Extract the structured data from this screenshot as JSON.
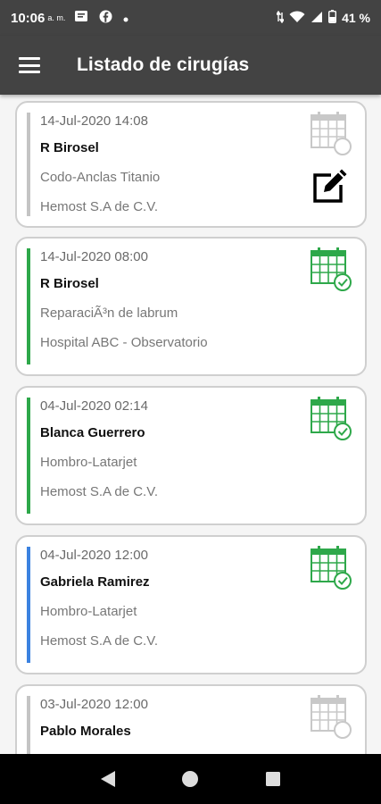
{
  "status_bar": {
    "time": "10:06",
    "ampm": "a. m.",
    "battery": "41 %",
    "icons": [
      "message-icon",
      "facebook-icon",
      "dot-icon",
      "data-arrows-icon",
      "wifi-icon",
      "signal-icon",
      "battery-icon"
    ]
  },
  "app_bar": {
    "title": "Listado de cirugías",
    "menu_icon": "hamburger-menu-icon"
  },
  "surgeries": [
    {
      "date": "14-Jul-2020 14:08",
      "patient": "R Birosel",
      "procedure": "Codo-Anclas Titanio",
      "hospital": "Hemost S.A de C.V.",
      "status": "pending",
      "bar_color": "#c4c4c4",
      "icon_color": "#c8c8c8",
      "has_edit": true
    },
    {
      "date": "14-Jul-2020 08:00",
      "patient": "R Birosel",
      "procedure": "ReparaciÃ³n de labrum",
      "hospital": "Hospital ABC - Observatorio",
      "status": "confirmed",
      "bar_color": "#2ea84a",
      "icon_color": "#2ea84a",
      "has_edit": false
    },
    {
      "date": "04-Jul-2020 02:14",
      "patient": "Blanca Guerrero",
      "procedure": "Hombro-Latarjet",
      "hospital": "Hemost S.A de C.V.",
      "status": "confirmed",
      "bar_color": "#2ea84a",
      "icon_color": "#2ea84a",
      "has_edit": false
    },
    {
      "date": "04-Jul-2020 12:00",
      "patient": "Gabriela Ramirez",
      "procedure": "Hombro-Latarjet",
      "hospital": "Hemost S.A de C.V.",
      "status": "confirmed",
      "bar_color": "#3b82e0",
      "icon_color": "#2ea84a",
      "has_edit": false
    },
    {
      "date": "03-Jul-2020 12:00",
      "patient": "Pablo Morales",
      "procedure": "",
      "hospital": "",
      "status": "pending",
      "bar_color": "#c4c4c4",
      "icon_color": "#c8c8c8",
      "has_edit": false
    }
  ],
  "nav_bar": {
    "buttons": [
      "back-icon",
      "home-icon",
      "recents-icon"
    ]
  }
}
